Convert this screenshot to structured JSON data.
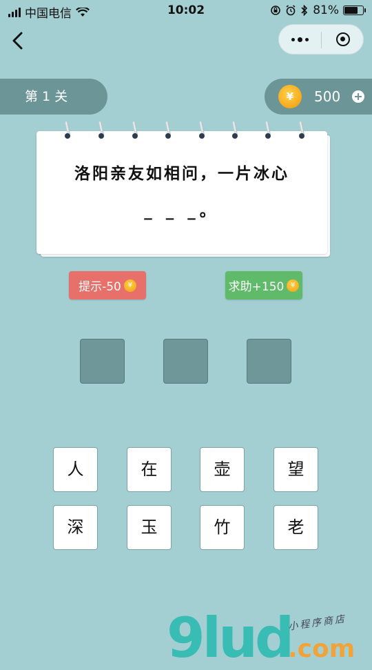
{
  "status": {
    "carrier": "中国电信",
    "time": "10:02",
    "battery_percent": "81%",
    "battery_level": 0.81
  },
  "level": {
    "label": "第 1 关"
  },
  "coins": {
    "count": "500",
    "symbol": "¥"
  },
  "puzzle": {
    "line": "洛阳亲友如相问，一片冰心",
    "blanks": "_ _ _。"
  },
  "buttons": {
    "hint": "提示-50",
    "help": "求助+150"
  },
  "tiles": [
    "人",
    "在",
    "壶",
    "望",
    "深",
    "玉",
    "竹",
    "老"
  ],
  "watermark": {
    "main": "9lud",
    "suffix": ".com",
    "tagline": "小程序商店"
  },
  "colors": {
    "background": "#a3cfd3",
    "panel": "#6c9597",
    "hint": "#e7706b",
    "help": "#5fba6a",
    "coin": "#f6a91c"
  }
}
